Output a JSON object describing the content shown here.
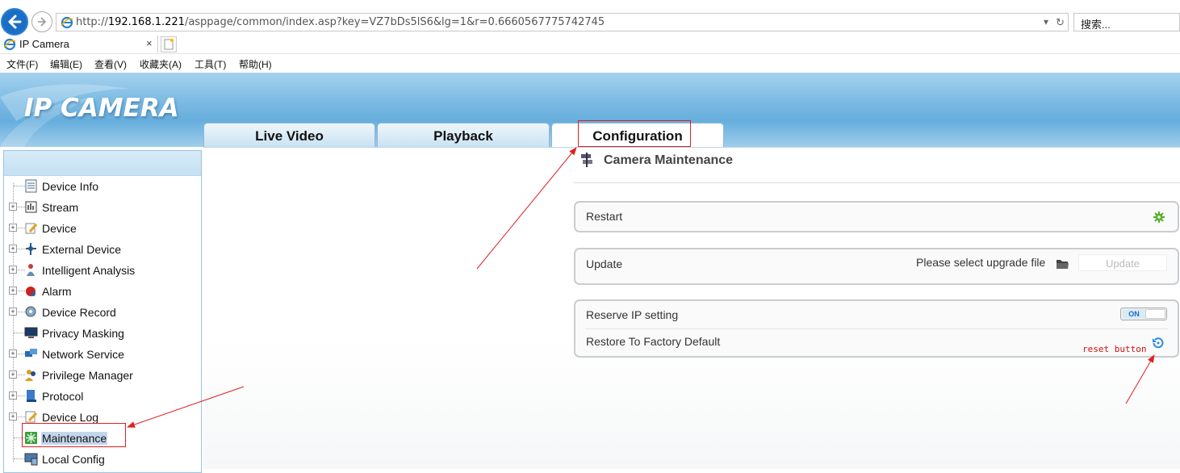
{
  "browser": {
    "url_prefix": "http://",
    "url_host": "192.168.1.221",
    "url_path": "/asppage/common/index.asp?key=VZ7bDs5lS6&lg=1&r=0.6660567775742745",
    "search_placeholder": "搜索...",
    "tab_title": "IP Camera",
    "tab_close": "×",
    "menu": [
      "文件(F)",
      "编辑(E)",
      "查看(V)",
      "收藏夹(A)",
      "工具(T)",
      "帮助(H)"
    ]
  },
  "app": {
    "logo": "IP CAMERA",
    "tabs": [
      "Live Video",
      "Playback",
      "Configuration"
    ],
    "active_tab": "Configuration"
  },
  "sidebar": {
    "items": [
      {
        "label": "Device Info",
        "expandable": false,
        "icon": "info-list-icon"
      },
      {
        "label": "Stream",
        "expandable": true,
        "icon": "stream-icon"
      },
      {
        "label": "Device",
        "expandable": true,
        "icon": "device-pencil-icon"
      },
      {
        "label": "External Device",
        "expandable": true,
        "icon": "external-device-icon"
      },
      {
        "label": "Intelligent Analysis",
        "expandable": true,
        "icon": "intelligent-analysis-icon"
      },
      {
        "label": "Alarm",
        "expandable": true,
        "icon": "alarm-icon"
      },
      {
        "label": "Device Record",
        "expandable": true,
        "icon": "record-icon"
      },
      {
        "label": "Privacy Masking",
        "expandable": false,
        "icon": "monitor-icon"
      },
      {
        "label": "Network Service",
        "expandable": true,
        "icon": "network-icon"
      },
      {
        "label": "Privilege Manager",
        "expandable": true,
        "icon": "users-icon"
      },
      {
        "label": "Protocol",
        "expandable": true,
        "icon": "protocol-icon"
      },
      {
        "label": "Device Log",
        "expandable": true,
        "icon": "log-icon"
      },
      {
        "label": "Maintenance",
        "expandable": false,
        "icon": "maintenance-icon",
        "selected": true
      },
      {
        "label": "Local Config",
        "expandable": false,
        "icon": "local-config-icon"
      }
    ]
  },
  "main": {
    "title": "Camera Maintenance",
    "restart_label": "Restart",
    "update_label": "Update",
    "update_prompt": "Please select upgrade file",
    "update_button": "Update",
    "reserve_ip_label": "Reserve IP setting",
    "reserve_ip_state": "ON",
    "restore_label": "Restore To Factory Default"
  },
  "annotations": {
    "reset_note": "reset button"
  },
  "colors": {
    "annotation": "#e02020",
    "header_blue": "#7fbde4"
  }
}
